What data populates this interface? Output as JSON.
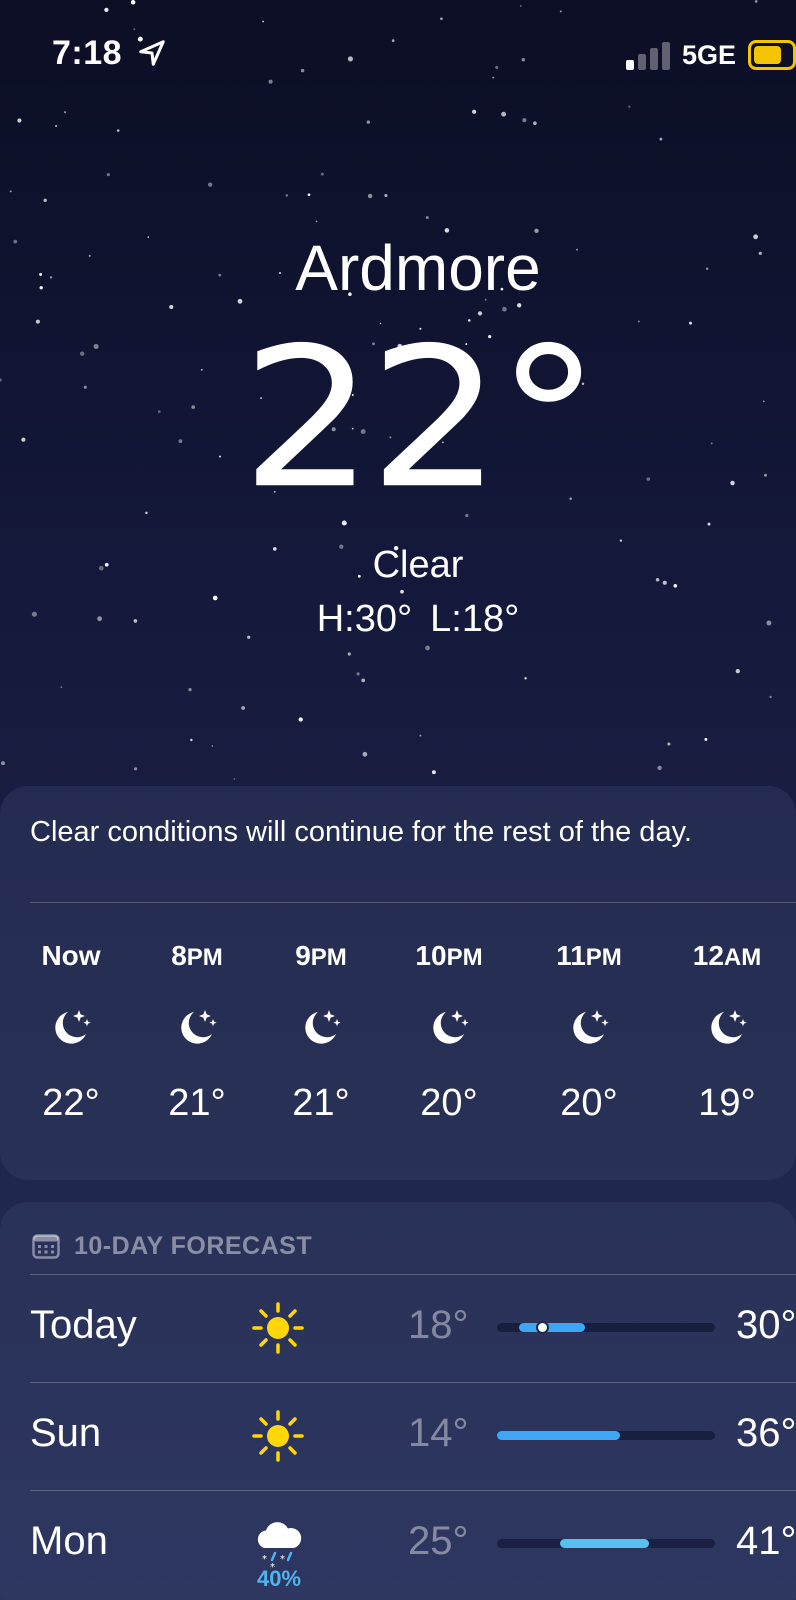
{
  "status_bar": {
    "time": "7:18",
    "network": "5GE",
    "signal_bars_active": 1,
    "signal_bars_total": 4,
    "battery_level": 0.75,
    "battery_color": "#f5c400"
  },
  "location": {
    "city": "Ardmore",
    "temperature": "22°",
    "condition": "Clear",
    "high": "H:30°",
    "low": "L:18°"
  },
  "hourly": {
    "summary": "Clear conditions will continue for the rest of the day.",
    "items": [
      {
        "label": "Now",
        "suffix": "",
        "icon": "moon-stars-icon",
        "temp": "22°"
      },
      {
        "label": "8",
        "suffix": "PM",
        "icon": "moon-stars-icon",
        "temp": "21°"
      },
      {
        "label": "9",
        "suffix": "PM",
        "icon": "moon-stars-icon",
        "temp": "21°"
      },
      {
        "label": "10",
        "suffix": "PM",
        "icon": "moon-stars-icon",
        "temp": "20°"
      },
      {
        "label": "11",
        "suffix": "PM",
        "icon": "moon-stars-icon",
        "temp": "20°"
      },
      {
        "label": "12",
        "suffix": "AM",
        "icon": "moon-stars-icon",
        "temp": "19°"
      }
    ]
  },
  "forecast": {
    "title": "10-DAY FORECAST",
    "range_min": 14,
    "range_max": 41,
    "days": [
      {
        "day": "Today",
        "icon": "sun-icon",
        "precip": "",
        "low": "18°",
        "high": "30°",
        "low_value": 18,
        "high_value": 30,
        "current": 22
      },
      {
        "day": "Sun",
        "icon": "sun-icon",
        "precip": "",
        "low": "14°",
        "high": "36°",
        "low_value": 14,
        "high_value": 36
      },
      {
        "day": "Mon",
        "icon": "cloud-rain-snow-icon",
        "precip": "40%",
        "low": "25°",
        "high": "41°",
        "low_value": 25,
        "high_value": 41
      }
    ]
  },
  "colors": {
    "bar_blue": "#3ea6f2",
    "bar_light_blue": "#56c0ee",
    "sun": "#ffd60a",
    "precip": "#4eb4f0"
  }
}
